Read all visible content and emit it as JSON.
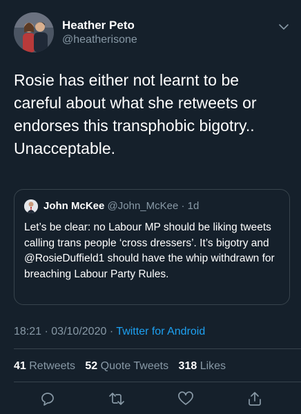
{
  "author": {
    "name": "Heather Peto",
    "handle": "@heatherisone"
  },
  "tweet": {
    "text": "Rosie has either not learnt to be careful about what she retweets or endorses this transphobic bigotry.. Unacceptable."
  },
  "quoted": {
    "name": "John McKee",
    "handle": "@John_McKee",
    "separator": "·",
    "time": "1d",
    "text": "Let’s be clear: no Labour MP should be liking tweets calling trans people ‘cross dressers’. It’s bigotry and @RosieDuffield1 should have the whip withdrawn for breaching Labour Party Rules."
  },
  "meta": {
    "time": "18:21",
    "sep1": "·",
    "date": "03/10/2020",
    "sep2": "·",
    "source": "Twitter for Android"
  },
  "stats": {
    "retweets_count": "41",
    "retweets_label": "Retweets",
    "quotes_count": "52",
    "quotes_label": "Quote Tweets",
    "likes_count": "318",
    "likes_label": "Likes"
  },
  "icons": {
    "caret": "chevron-down-icon",
    "reply": "reply-icon",
    "retweet": "retweet-icon",
    "like": "heart-icon",
    "share": "share-icon"
  },
  "colors": {
    "background": "#15202b",
    "secondary": "#8899a6",
    "accent": "#1da1f2",
    "border": "#38444d"
  }
}
